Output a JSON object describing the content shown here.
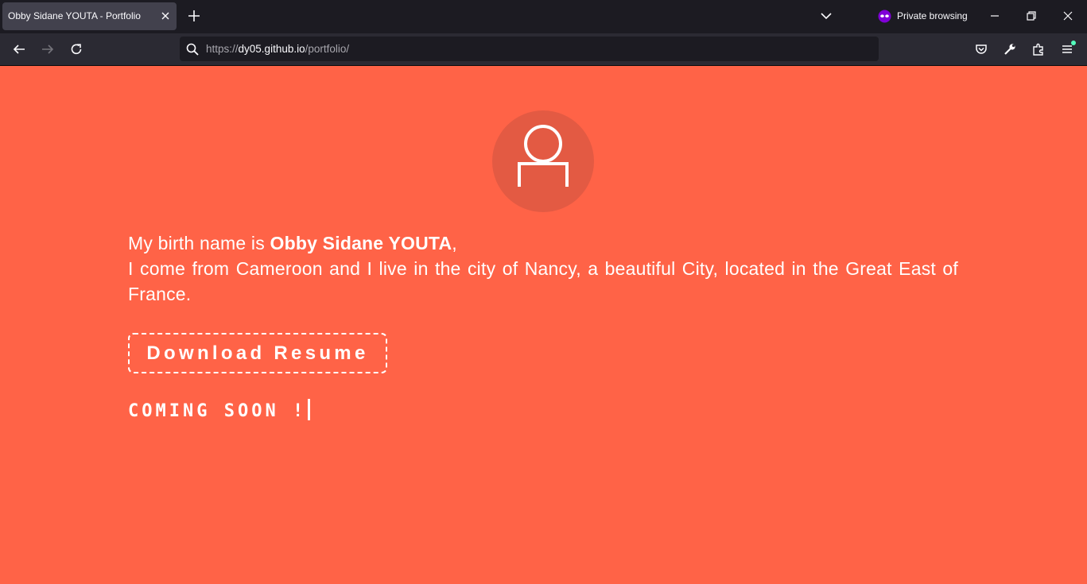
{
  "browser": {
    "tab": {
      "title": "Obby Sidane YOUTA - Portfolio"
    },
    "private_label": "Private browsing",
    "url": {
      "scheme": "https://",
      "host": "dy05.github.io",
      "path": "/portfolio/"
    }
  },
  "page": {
    "bio": {
      "prefix": "My birth name is ",
      "name": "Obby Sidane YOUTA",
      "suffix": ",",
      "line2": "I come from Cameroon and I live in the city of Nancy, a beautiful City, located in the Great East of France."
    },
    "download_label": "Download Resume",
    "coming_soon": "COMING SOON !"
  },
  "colors": {
    "background": "#ff6347",
    "avatar_bg": "#e35a43",
    "tabbar": "#1c1b22",
    "navbar": "#2b2a33",
    "private_icon": "#8000d7"
  }
}
